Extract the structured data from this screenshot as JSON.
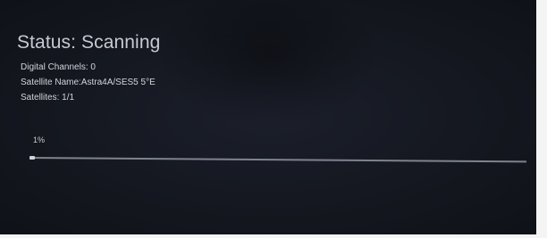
{
  "status": {
    "label": "Status:",
    "value": "Scanning"
  },
  "info": {
    "digital_channels": "Digital Channels:  0",
    "satellite_name": "Satellite Name:Astra4A/SES5 5°E",
    "satellites": "Satellites:  1/1"
  },
  "progress": {
    "label": "1%",
    "fraction": 0.01
  },
  "colors": {
    "background": "#14171f",
    "text": "#d2d5dc",
    "track": "#8a8f9a",
    "fill": "#e6e8ee"
  }
}
